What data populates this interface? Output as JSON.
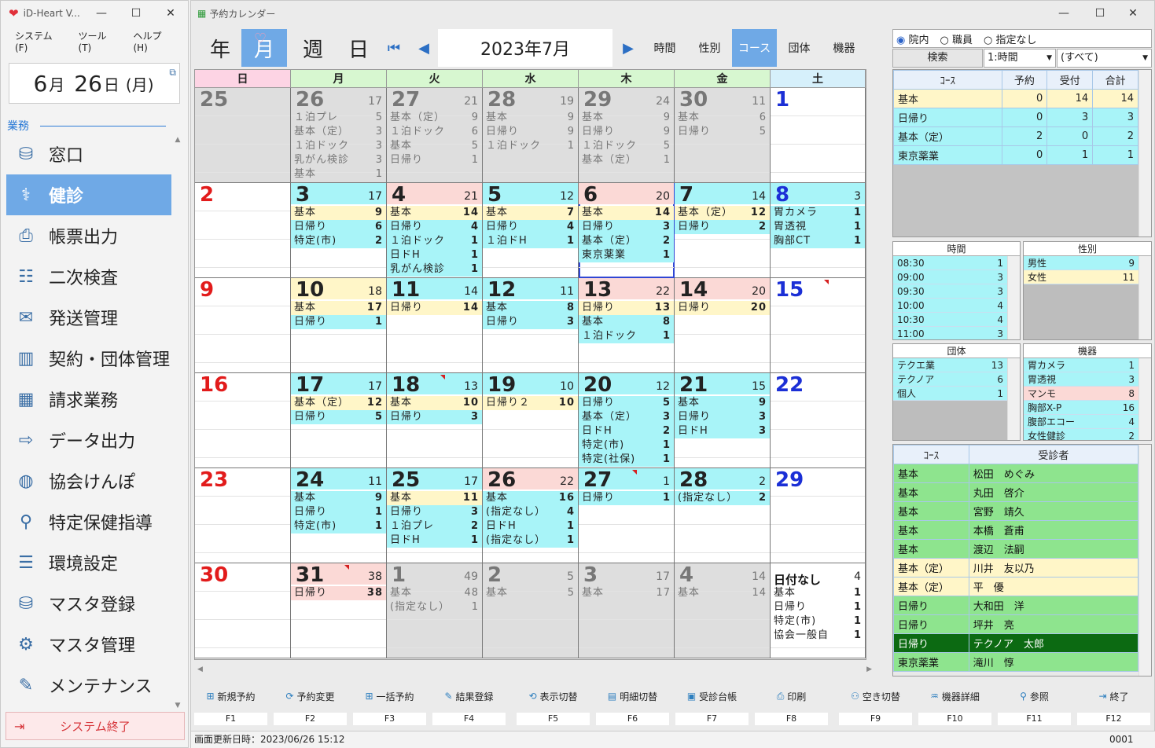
{
  "left_window": {
    "title": "iD-Heart V...",
    "menu": [
      "システム(F)",
      "ツール(T)",
      "ヘルプ(H)"
    ],
    "date": {
      "month": "6",
      "month_unit": "月",
      "day": "26",
      "day_unit": "日",
      "weekday": "(月)"
    },
    "section": "業務",
    "nav": [
      {
        "label": "窓口",
        "icon": "reception-icon"
      },
      {
        "label": "健診",
        "icon": "stethoscope-icon"
      },
      {
        "label": "帳票出力",
        "icon": "printer-icon"
      },
      {
        "label": "二次検査",
        "icon": "chat-icon"
      },
      {
        "label": "発送管理",
        "icon": "shipping-icon"
      },
      {
        "label": "契約・団体管理",
        "icon": "building-icon"
      },
      {
        "label": "請求業務",
        "icon": "calculator-icon"
      },
      {
        "label": "データ出力",
        "icon": "export-icon"
      },
      {
        "label": "協会けんぽ",
        "icon": "globe-icon"
      },
      {
        "label": "特定保健指導",
        "icon": "person-search-icon"
      },
      {
        "label": "環境設定",
        "icon": "sliders-icon"
      },
      {
        "label": "マスタ登録",
        "icon": "db-add-icon"
      },
      {
        "label": "マスタ管理",
        "icon": "db-gear-icon"
      },
      {
        "label": "メンテナンス",
        "icon": "maintenance-icon"
      }
    ],
    "quit_label": "システム終了"
  },
  "main": {
    "title": "予約カレンダー",
    "views": [
      "年",
      "月",
      "週",
      "日"
    ],
    "month_label": "2023年7月",
    "filters": [
      "時間",
      "性別",
      "コース",
      "団体",
      "機器"
    ],
    "weekdays": [
      "日",
      "月",
      "火",
      "水",
      "木",
      "金",
      "土"
    ],
    "weeks": [
      [
        {
          "d": "25",
          "t": "",
          "g": 1,
          "i": []
        },
        {
          "d": "26",
          "t": "17",
          "g": 1,
          "i": [
            [
              "１泊プレ",
              "5"
            ],
            [
              "基本（定）",
              "3"
            ],
            [
              "１泊ドック",
              "3"
            ],
            [
              "乳がん検診",
              "3"
            ],
            [
              "基本",
              "1"
            ]
          ]
        },
        {
          "d": "27",
          "t": "21",
          "g": 1,
          "i": [
            [
              "基本（定）",
              "9"
            ],
            [
              "１泊ドック",
              "6"
            ],
            [
              "基本",
              "5"
            ],
            [
              "日帰り",
              "1"
            ]
          ]
        },
        {
          "d": "28",
          "t": "19",
          "g": 1,
          "i": [
            [
              "基本",
              "9"
            ],
            [
              "日帰り",
              "9"
            ],
            [
              "１泊ドック",
              "1"
            ]
          ]
        },
        {
          "d": "29",
          "t": "24",
          "g": 1,
          "i": [
            [
              "基本",
              "9"
            ],
            [
              "日帰り",
              "9"
            ],
            [
              "１泊ドック",
              "5"
            ],
            [
              "基本（定）",
              "1"
            ]
          ]
        },
        {
          "d": "30",
          "t": "11",
          "g": 1,
          "i": [
            [
              "基本",
              "6"
            ],
            [
              "日帰り",
              "5"
            ]
          ]
        },
        {
          "d": "1",
          "t": "",
          "g": 0,
          "i": []
        }
      ],
      [
        {
          "d": "2",
          "t": "",
          "h": "",
          "i": []
        },
        {
          "d": "3",
          "t": "17",
          "h": "cyan",
          "i": [
            [
              "基本",
              "9",
              "y"
            ],
            [
              "日帰り",
              "6",
              "c"
            ],
            [
              "特定(市)",
              "2",
              "c"
            ]
          ]
        },
        {
          "d": "4",
          "t": "21",
          "h": "pink",
          "i": [
            [
              "基本",
              "14",
              "y"
            ],
            [
              "日帰り",
              "4",
              "c"
            ],
            [
              "１泊ドック",
              "1",
              "c"
            ],
            [
              "日ドH",
              "1",
              "c"
            ],
            [
              "乳がん検診",
              "1",
              "c"
            ]
          ]
        },
        {
          "d": "5",
          "t": "12",
          "h": "cyan",
          "i": [
            [
              "基本",
              "7",
              "y"
            ],
            [
              "日帰り",
              "4",
              "c"
            ],
            [
              "１泊ドH",
              "1",
              "c"
            ]
          ]
        },
        {
          "d": "6",
          "t": "20",
          "h": "pink",
          "sel": 1,
          "i": [
            [
              "基本",
              "14",
              "y"
            ],
            [
              "日帰り",
              "3",
              "c"
            ],
            [
              "基本（定）",
              "2",
              "c"
            ],
            [
              "東京薬業",
              "1",
              "c"
            ]
          ]
        },
        {
          "d": "7",
          "t": "14",
          "h": "cyan",
          "i": [
            [
              "基本（定）",
              "12",
              "y"
            ],
            [
              "日帰り",
              "2",
              "c"
            ]
          ]
        },
        {
          "d": "8",
          "t": "3",
          "h": "cyan",
          "i": [
            [
              "胃カメラ",
              "1",
              "c"
            ],
            [
              "胃透視",
              "1",
              "c"
            ],
            [
              "胸部CT",
              "1",
              "c"
            ]
          ]
        }
      ],
      [
        {
          "d": "9",
          "t": "",
          "h": "",
          "i": []
        },
        {
          "d": "10",
          "t": "18",
          "h": "yellow",
          "i": [
            [
              "基本",
              "17",
              "y"
            ],
            [
              "日帰り",
              "1",
              "c"
            ]
          ]
        },
        {
          "d": "11",
          "t": "14",
          "h": "cyan",
          "i": [
            [
              "日帰り",
              "14",
              "y"
            ]
          ]
        },
        {
          "d": "12",
          "t": "11",
          "h": "cyan",
          "i": [
            [
              "基本",
              "8",
              "c"
            ],
            [
              "日帰り",
              "3",
              "c"
            ]
          ]
        },
        {
          "d": "13",
          "t": "22",
          "h": "pink",
          "i": [
            [
              "日帰り",
              "13",
              "y"
            ],
            [
              "基本",
              "8",
              "c"
            ],
            [
              "１泊ドック",
              "1",
              "c"
            ]
          ]
        },
        {
          "d": "14",
          "t": "20",
          "h": "pink",
          "i": [
            [
              "日帰り",
              "20",
              "y"
            ]
          ]
        },
        {
          "d": "15",
          "t": "",
          "h": "",
          "flag": 1,
          "i": []
        }
      ],
      [
        {
          "d": "16",
          "t": "",
          "h": "",
          "i": []
        },
        {
          "d": "17",
          "t": "17",
          "h": "cyan",
          "i": [
            [
              "基本（定）",
              "12",
              "y"
            ],
            [
              "日帰り",
              "5",
              "c"
            ]
          ]
        },
        {
          "d": "18",
          "t": "13",
          "h": "cyan",
          "flag": 1,
          "i": [
            [
              "基本",
              "10",
              "y"
            ],
            [
              "日帰り",
              "3",
              "c"
            ]
          ]
        },
        {
          "d": "19",
          "t": "10",
          "h": "cyan",
          "i": [
            [
              "日帰り２",
              "10",
              "y"
            ]
          ]
        },
        {
          "d": "20",
          "t": "12",
          "h": "cyan",
          "i": [
            [
              "日帰り",
              "5",
              "c"
            ],
            [
              "基本（定）",
              "3",
              "c"
            ],
            [
              "日ドH",
              "2",
              "c"
            ],
            [
              "特定(市)",
              "1",
              "c"
            ],
            [
              "特定(社保)",
              "1",
              "c"
            ]
          ]
        },
        {
          "d": "21",
          "t": "15",
          "h": "cyan",
          "i": [
            [
              "基本",
              "9",
              "c"
            ],
            [
              "日帰り",
              "3",
              "c"
            ],
            [
              "日ドH",
              "3",
              "c"
            ]
          ]
        },
        {
          "d": "22",
          "t": "",
          "h": "",
          "i": []
        }
      ],
      [
        {
          "d": "23",
          "t": "",
          "h": "",
          "i": []
        },
        {
          "d": "24",
          "t": "11",
          "h": "cyan",
          "i": [
            [
              "基本",
              "9",
              "c"
            ],
            [
              "日帰り",
              "1",
              "c"
            ],
            [
              "特定(市)",
              "1",
              "c"
            ]
          ]
        },
        {
          "d": "25",
          "t": "17",
          "h": "cyan",
          "i": [
            [
              "基本",
              "11",
              "y"
            ],
            [
              "日帰り",
              "3",
              "c"
            ],
            [
              "１泊プレ",
              "2",
              "c"
            ],
            [
              "日ドH",
              "1",
              "c"
            ]
          ]
        },
        {
          "d": "26",
          "t": "22",
          "h": "pink",
          "i": [
            [
              "基本",
              "16",
              "c"
            ],
            [
              "(指定なし）",
              "4",
              "c"
            ],
            [
              "日ドH",
              "1",
              "c"
            ],
            [
              "(指定なし）",
              "1",
              "c"
            ]
          ]
        },
        {
          "d": "27",
          "t": "1",
          "h": "cyan",
          "flag": 1,
          "i": [
            [
              "日帰り",
              "1",
              "c"
            ]
          ]
        },
        {
          "d": "28",
          "t": "2",
          "h": "cyan",
          "i": [
            [
              "(指定なし）",
              "2",
              "c"
            ]
          ]
        },
        {
          "d": "29",
          "t": "",
          "h": "",
          "i": []
        }
      ],
      [
        {
          "d": "30",
          "t": "",
          "h": "",
          "i": []
        },
        {
          "d": "31",
          "t": "38",
          "h": "pink",
          "flag": 1,
          "i": [
            [
              "日帰り",
              "38",
              "p"
            ]
          ]
        },
        {
          "d": "1",
          "t": "49",
          "g": 1,
          "i": [
            [
              "基本",
              "48"
            ],
            [
              "(指定なし）",
              "1"
            ]
          ]
        },
        {
          "d": "2",
          "t": "5",
          "g": 1,
          "i": [
            [
              "基本",
              "5"
            ]
          ]
        },
        {
          "d": "3",
          "t": "17",
          "g": 1,
          "i": [
            [
              "基本",
              "17"
            ]
          ]
        },
        {
          "d": "4",
          "t": "14",
          "g": 1,
          "i": [
            [
              "基本",
              "14"
            ]
          ]
        },
        {
          "d": "日付なし",
          "t": "4",
          "h": "nodate",
          "i": [
            [
              "基本",
              "1",
              "w"
            ],
            [
              "日帰り",
              "1",
              "w"
            ],
            [
              "特定(市)",
              "1",
              "w"
            ],
            [
              "協会一般自",
              "1",
              "w"
            ]
          ]
        }
      ]
    ],
    "right": {
      "radios": [
        "院内",
        "職員",
        "指定なし"
      ],
      "search_label": "検索",
      "sel1": "1:時間",
      "sel2": "(すべて)",
      "course_headers": [
        "ｺｰｽ",
        "予約",
        "受付",
        "合計"
      ],
      "course_rows": [
        [
          "基本",
          "0",
          "14",
          "14"
        ],
        [
          "日帰り",
          "0",
          "3",
          "3"
        ],
        [
          "基本（定）",
          "2",
          "0",
          "2"
        ],
        [
          "東京薬業",
          "0",
          "1",
          "1"
        ]
      ],
      "time": {
        "title": "時間",
        "rows": [
          [
            "08:30",
            "1"
          ],
          [
            "09:00",
            "3"
          ],
          [
            "09:30",
            "3"
          ],
          [
            "10:00",
            "4"
          ],
          [
            "10:30",
            "4"
          ],
          [
            "11:00",
            "3"
          ]
        ]
      },
      "sex": {
        "title": "性別",
        "rows": [
          [
            "男性",
            "9"
          ],
          [
            "女性",
            "11"
          ]
        ]
      },
      "group": {
        "title": "団体",
        "rows": [
          [
            "テクエ業",
            "13"
          ],
          [
            "テクノア",
            "6"
          ],
          [
            "個人",
            "1"
          ]
        ]
      },
      "device": {
        "title": "機器",
        "rows": [
          [
            "胃カメラ",
            "1"
          ],
          [
            "胃透視",
            "3"
          ],
          [
            "マンモ",
            "8"
          ],
          [
            "胸部X-P",
            "16"
          ],
          [
            "腹部エコー",
            "4"
          ],
          [
            "女性健診",
            "2"
          ]
        ]
      },
      "patient_headers": [
        "ｺｰｽ",
        "受診者"
      ],
      "patients": [
        [
          "基本",
          "松田　めぐみ"
        ],
        [
          "基本",
          "丸田　啓介"
        ],
        [
          "基本",
          "宮野　靖久"
        ],
        [
          "基本",
          "本橋　蒼甫"
        ],
        [
          "基本",
          "渡辺　法嗣"
        ],
        [
          "基本（定）",
          "川井　友以乃"
        ],
        [
          "基本（定）",
          "平　優"
        ],
        [
          "日帰り",
          "大和田　洋"
        ],
        [
          "日帰り",
          "坪井　亮"
        ],
        [
          "日帰り",
          "テクノア　太郎"
        ],
        [
          "東京薬業",
          "滝川　惇"
        ]
      ]
    },
    "fkeys": [
      [
        "新規予約",
        "F1"
      ],
      [
        "予約変更",
        "F2"
      ],
      [
        "一括予約",
        "F3"
      ],
      [
        "結果登録",
        "F4"
      ],
      [
        "表示切替",
        "F5"
      ],
      [
        "明細切替",
        "F6"
      ],
      [
        "受診台帳",
        "F7"
      ],
      [
        "印刷",
        "F8"
      ],
      [
        "空き切替",
        "F9"
      ],
      [
        "機器詳細",
        "F10"
      ],
      [
        "参照",
        "F11"
      ],
      [
        "終了",
        "F12"
      ]
    ],
    "status_text": "画面更新日時：2023/06/26 15:12",
    "status_code": "0001",
    "colors": {
      "accent": "#6fa9e6",
      "cyan": "#a8f4f8",
      "yellow": "#fff6c8",
      "pink": "#fbd9d6",
      "sunday": "#e21b1b",
      "saturday": "#1b2fd6"
    }
  }
}
